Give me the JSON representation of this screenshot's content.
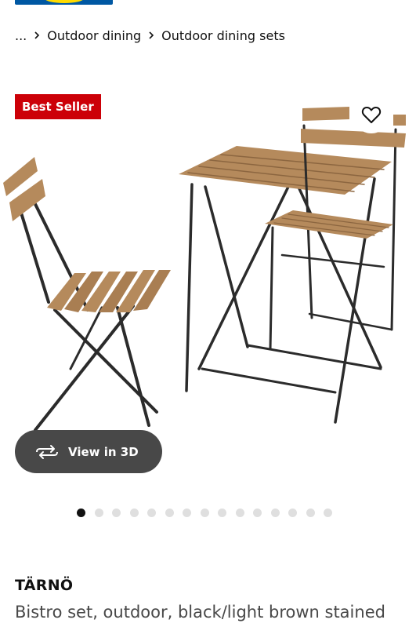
{
  "header": {
    "logo_colors": {
      "blue": "#0058a3",
      "yellow": "#ffdb00"
    }
  },
  "breadcrumb": {
    "ellipsis": "...",
    "items": [
      {
        "label": "Outdoor dining"
      },
      {
        "label": "Outdoor dining sets"
      }
    ]
  },
  "product": {
    "badge": "Best Seller",
    "badge_color": "#cc0008",
    "view_3d_label": "View in 3D",
    "name": "TÄRNÖ",
    "description": "Bistro set, outdoor, black/light brown stained",
    "wishlist_icon": "heart-icon",
    "gallery": {
      "image_count": 15,
      "active_index": 0
    }
  }
}
